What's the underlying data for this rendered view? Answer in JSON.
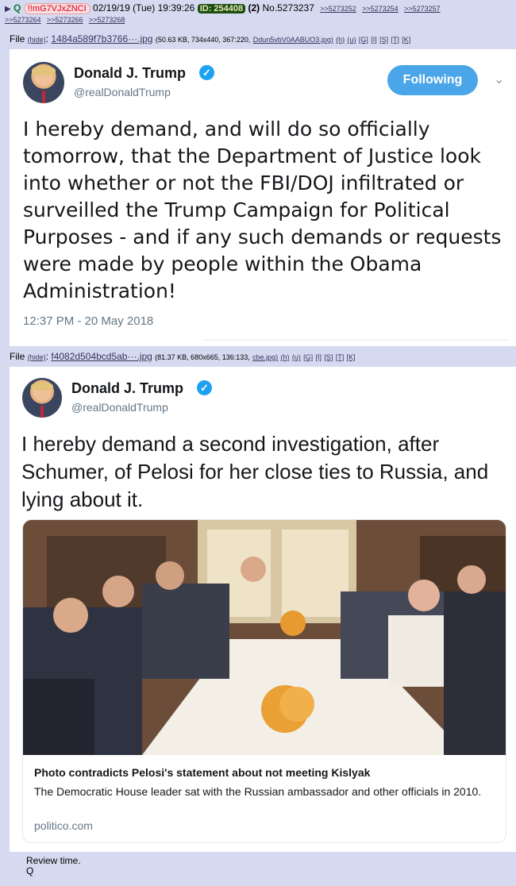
{
  "post": {
    "arrow": "▶",
    "name": "Q",
    "tripcode": "!!mG7VJxZNCI",
    "date": "02/19/19 (Tue) 19:39:26",
    "id_label": "ID: 254408",
    "reply_count": "(2)",
    "number": "No.5273237",
    "backlinks": [
      ">>5273252",
      ">>5273254",
      ">>5273257",
      ">>5273264",
      ">>5273266",
      ">>5273268"
    ],
    "message_lines": [
      "Review time.",
      "Q"
    ]
  },
  "files": [
    {
      "label": "File",
      "hide": "(hide)",
      "name": "1484a589f7b3766···.jpg",
      "meta": "(50.63 KB, 734x440, 367:220,",
      "orig": "Ddun5vbV0AABUO3.jpg)",
      "actions": [
        "(h)",
        "(u)",
        "[G]",
        "[I]",
        "[S]",
        "[T]",
        "[K]"
      ]
    },
    {
      "label": "File",
      "hide": "(hide)",
      "name": "f4082d504bcd5ab···.jpg",
      "meta": "(81.37 KB, 680x665, 136:133,",
      "orig": "cbe.jpg)",
      "actions": [
        "(h)",
        "(u)",
        "[G]",
        "[I]",
        "[S]",
        "[T]",
        "[K]"
      ]
    }
  ],
  "tweet1": {
    "name": "Donald J. Trump",
    "handle": "@realDonaldTrump",
    "follow_label": "Following",
    "text": "I hereby demand, and will do so officially tomorrow, that the Department of Justice look into whether or not the FBI/DOJ infiltrated or surveilled the Trump Campaign for Political Purposes - and if any such demands or requests were made by people within the Obama Administration!",
    "timestamp": "12:37 PM - 20 May 2018"
  },
  "tweet2": {
    "name": "Donald J. Trump",
    "handle": "@realDonaldTrump",
    "text": "I hereby demand a second investigation, after Schumer, of Pelosi for her close ties to Russia, and lying about it.",
    "card": {
      "title": "Photo contradicts Pelosi's statement about not meeting Kislyak",
      "description": "The Democratic House leader sat with the Russian ambassador and other officials in 2010.",
      "domain": "politico.com"
    }
  },
  "colors": {
    "background": "#d6daf0",
    "tweet_blue": "#1da1f2",
    "id_badge": "#1b4e10",
    "name_green": "#117743"
  },
  "icons": [
    "verified-badge-icon",
    "chevron-down-icon",
    "avatar"
  ]
}
